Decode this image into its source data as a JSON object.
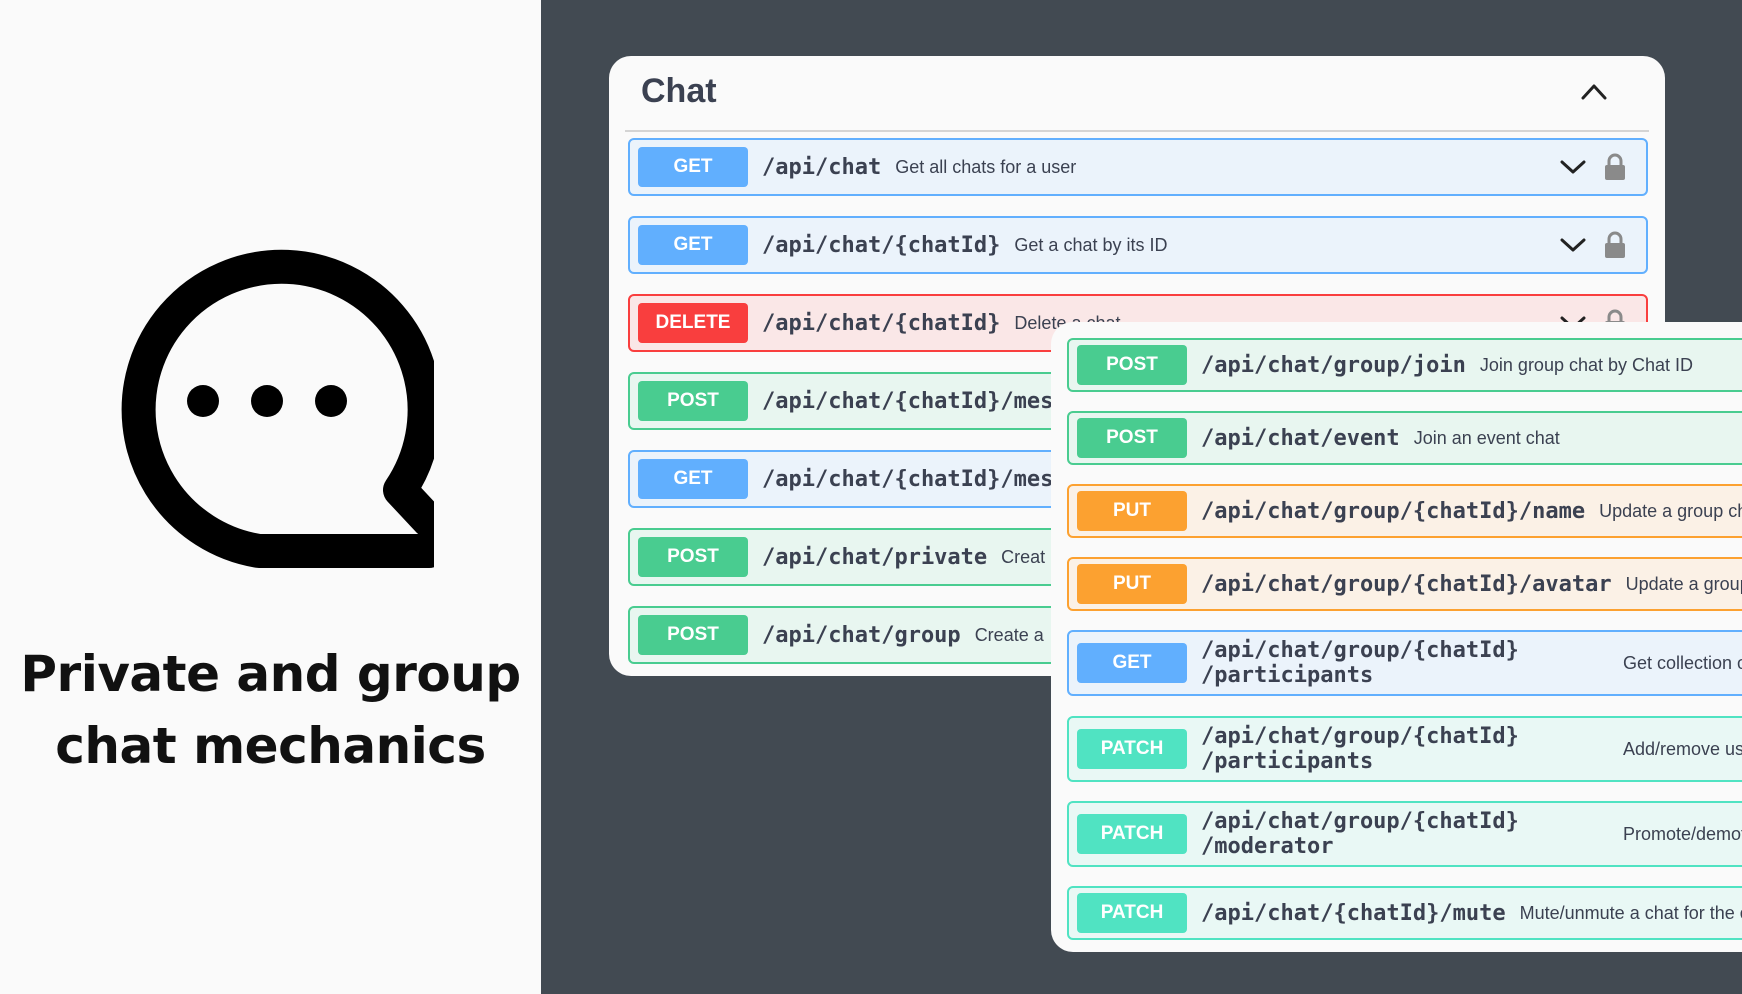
{
  "headline": {
    "line1": "Private and group",
    "line2": "chat mechanics"
  },
  "icons": {
    "chat": "chat-bubble-ellipsis-icon",
    "collapse": "chevron-up-icon",
    "expand": "chevron-down-icon",
    "lock": "lock-icon"
  },
  "colors": {
    "get": "#61affe",
    "post": "#49cc90",
    "delete": "#f93e3e",
    "put": "#fca130",
    "patch": "#50e3c2",
    "background_dark": "#424a52"
  },
  "chat_section": {
    "title": "Chat",
    "operations": [
      {
        "method": "GET",
        "path": "/api/chat",
        "description": "Get all chats for a user"
      },
      {
        "method": "GET",
        "path": "/api/chat/{chatId}",
        "description": "Get a chat by its ID"
      },
      {
        "method": "DELETE",
        "path": "/api/chat/{chatId}",
        "description": "Delete a chat"
      },
      {
        "method": "POST",
        "path": "/api/chat/{chatId}/mes",
        "description": ""
      },
      {
        "method": "GET",
        "path": "/api/chat/{chatId}/mes",
        "description": ""
      },
      {
        "method": "POST",
        "path": "/api/chat/private",
        "description": "Creat"
      },
      {
        "method": "POST",
        "path": "/api/chat/group",
        "description": "Create a"
      }
    ]
  },
  "group_section": {
    "operations": [
      {
        "method": "POST",
        "path": "/api/chat/group/join",
        "description": "Join group chat by Chat ID"
      },
      {
        "method": "POST",
        "path": "/api/chat/event",
        "description": "Join an event chat"
      },
      {
        "method": "PUT",
        "path": "/api/chat/group/{chatId}/name",
        "description": "Update a group chat na"
      },
      {
        "method": "PUT",
        "path": "/api/chat/group/{chatId}/avatar",
        "description": "Update a group cha"
      },
      {
        "method": "GET",
        "path": "/api/chat/group/{chatId}",
        "path_line2": "/participants",
        "description": "Get collection of"
      },
      {
        "method": "PATCH",
        "path": "/api/chat/group/{chatId}",
        "path_line2": "/participants",
        "description": "Add/remove use"
      },
      {
        "method": "PATCH",
        "path": "/api/chat/group/{chatId}",
        "path_line2": "/moderator",
        "description": "Promote/demote"
      },
      {
        "method": "PATCH",
        "path": "/api/chat/{chatId}/mute",
        "description": "Mute/unmute a chat for the curre"
      }
    ]
  }
}
